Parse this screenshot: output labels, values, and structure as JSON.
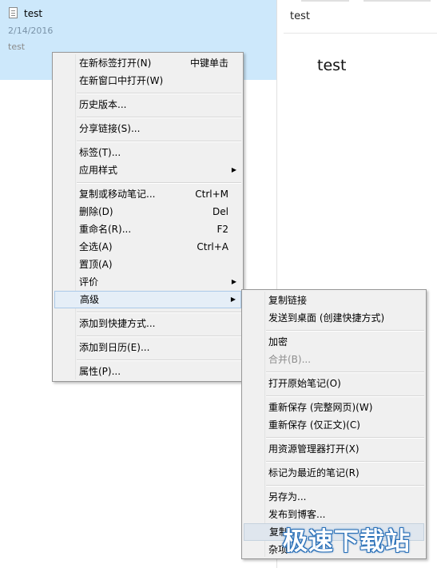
{
  "note_list": {
    "item": {
      "title": "test",
      "date": "2/14/2016",
      "snippet": "test"
    }
  },
  "note_view": {
    "title": "test",
    "body": "test"
  },
  "context_menu": {
    "items": [
      {
        "label": "在新标签打开(N)",
        "shortcut": "中键单击"
      },
      {
        "label": "在新窗口中打开(W)"
      },
      {
        "label": "历史版本..."
      },
      {
        "label": "分享链接(S)..."
      },
      {
        "label": "标签(T)..."
      },
      {
        "label": "应用样式"
      },
      {
        "label": "复制或移动笔记...",
        "shortcut": "Ctrl+M"
      },
      {
        "label": "删除(D)",
        "shortcut": "Del"
      },
      {
        "label": "重命名(R)...",
        "shortcut": "F2"
      },
      {
        "label": "全选(A)",
        "shortcut": "Ctrl+A"
      },
      {
        "label": "置顶(A)"
      },
      {
        "label": "评价"
      },
      {
        "label": "高级"
      },
      {
        "label": "添加到快捷方式..."
      },
      {
        "label": "添加到日历(E)..."
      },
      {
        "label": "属性(P)..."
      }
    ]
  },
  "submenu": {
    "items": [
      {
        "label": "复制链接"
      },
      {
        "label": "发送到桌面 (创建快捷方式)"
      },
      {
        "label": "加密"
      },
      {
        "label": "合并(B)..."
      },
      {
        "label": "打开原始笔记(O)"
      },
      {
        "label": "重新保存 (完整网页)(W)"
      },
      {
        "label": "重新保存 (仅正文)(C)"
      },
      {
        "label": "用资源管理器打开(X)"
      },
      {
        "label": "标记为最近的笔记(R)"
      },
      {
        "label": "另存为..."
      },
      {
        "label": "发布到博客..."
      },
      {
        "label": "复制..."
      },
      {
        "label": "杂项"
      }
    ]
  },
  "watermark": "极速下载站",
  "colors": {
    "selected_note_bg": "#cde8fb",
    "menu_bg": "#f0f0f0",
    "highlight_bg": "#e5eef7",
    "watermark_outline": "#2a70b8"
  }
}
